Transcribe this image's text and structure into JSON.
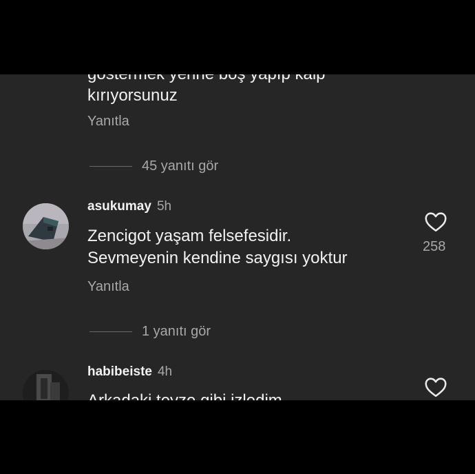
{
  "previous_comment": {
    "text_line_cut": "göstermek yerine boş yapıp kalp",
    "text_line_last": "kırıyorsunuz",
    "reply_label": "Yanıtla",
    "view_replies": "45 yanıtı gör"
  },
  "comment_asukumay": {
    "username": "asukumay",
    "time": "5h",
    "line1": "Zencigot yaşam felsefesidir.",
    "line2": "Sevmeyenin kendine saygısı yoktur",
    "like_count": "258",
    "reply_label": "Yanıtla",
    "view_replies": "1 yanıtı gör"
  },
  "comment_habibeiste": {
    "username": "habibeiste",
    "time": "4h",
    "line1": "Arkadaki teyze gibi izledim"
  },
  "icons": {
    "like": "heart-outline-icon"
  },
  "colors": {
    "background": "#262626",
    "text": "#f2f2f2",
    "secondary_text": "#a8a8a8"
  }
}
